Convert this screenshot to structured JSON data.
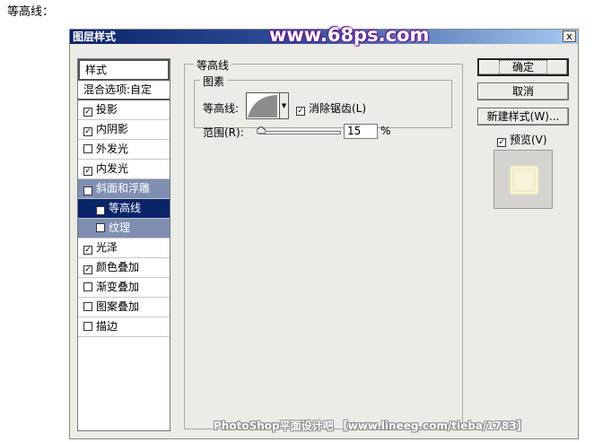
{
  "caption": "等高线：",
  "window": {
    "title": "图层样式",
    "logo_text": "www.68ps.com",
    "close_label": "x"
  },
  "style_list": {
    "header": "样式",
    "blend": "混合选项:自定",
    "items": [
      {
        "label": "投影",
        "checked": true
      },
      {
        "label": "内阴影",
        "checked": true
      },
      {
        "label": "外发光",
        "checked": false
      },
      {
        "label": "内发光",
        "checked": true
      },
      {
        "label": "斜面和浮雕",
        "checked": true
      },
      {
        "label": "等高线",
        "checked": true
      },
      {
        "label": "纹理",
        "checked": false
      },
      {
        "label": "光泽",
        "checked": true
      },
      {
        "label": "颜色叠加",
        "checked": true
      },
      {
        "label": "渐变叠加",
        "checked": false
      },
      {
        "label": "图案叠加",
        "checked": false
      },
      {
        "label": "描边",
        "checked": false
      }
    ]
  },
  "contour_panel": {
    "group_title": "等高线",
    "subgroup_title": "图素",
    "contour_label": "等高线:",
    "antialias_label": "消除锯齿(L)",
    "antialias_checked": true,
    "range_label": "范围(R):",
    "range_value": "15",
    "range_unit": "%"
  },
  "buttons": {
    "ok": "确定",
    "cancel": "取消",
    "new_style": "新建样式(W)...",
    "preview_label": "预览(V)",
    "preview_checked": true
  },
  "watermark": "PhotoShop平面设计吧 【www.lineeg.com/tieba/1783】"
}
